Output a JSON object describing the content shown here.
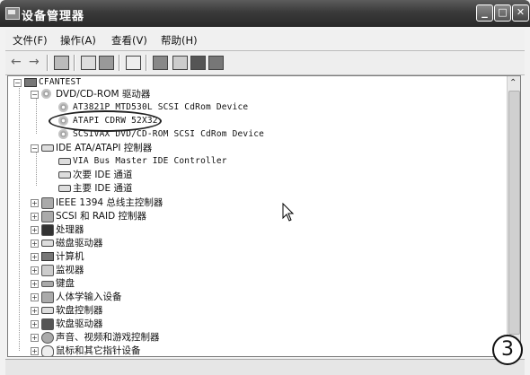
{
  "window": {
    "title": "设备管理器",
    "min_label": "_",
    "max_label": "□",
    "close_label": "✕"
  },
  "menu": [
    {
      "label": "文件(F)"
    },
    {
      "label": "操作(A)"
    },
    {
      "label": "查看(V)"
    },
    {
      "label": "帮助(H)"
    }
  ],
  "toolbar": {
    "back_icon": "arrow-left-icon",
    "forward_icon": "arrow-right-icon",
    "back_glyph": "←",
    "forward_glyph": "→"
  },
  "tree": {
    "root": "CFANTEST",
    "items": [
      {
        "label": "DVD/CD-ROM 驱动器",
        "icon": "cdrom-icon",
        "expander": "−"
      },
      {
        "label": "AT3821P MTD530L SCSI CdRom Device",
        "icon": "cdrom-icon"
      },
      {
        "label": "ATAPI CDRW 52X32",
        "icon": "cdrom-icon"
      },
      {
        "label": "SCSIVAX DVD/CD-ROM SCSI CdRom Device",
        "icon": "cdrom-icon"
      },
      {
        "label": "IDE ATA/ATAPI 控制器",
        "icon": "ide-icon",
        "expander": "−"
      },
      {
        "label": "VIA Bus Master IDE Controller",
        "icon": "ide-icon"
      },
      {
        "label": "次要 IDE 通道",
        "icon": "ide-icon"
      },
      {
        "label": "主要 IDE 通道",
        "icon": "ide-icon"
      },
      {
        "label": "IEEE 1394 总线主控制器",
        "icon": "firewire-icon",
        "expander": "+"
      },
      {
        "label": "SCSI 和 RAID 控制器",
        "icon": "scsi-icon",
        "expander": "+"
      },
      {
        "label": "处理器",
        "icon": "processor-icon",
        "expander": "+"
      },
      {
        "label": "磁盘驱动器",
        "icon": "disk-icon",
        "expander": "+"
      },
      {
        "label": "计算机",
        "icon": "computer-icon",
        "expander": "+"
      },
      {
        "label": "监视器",
        "icon": "monitor-icon",
        "expander": "+"
      },
      {
        "label": "键盘",
        "icon": "keyboard-icon",
        "expander": "+"
      },
      {
        "label": "人体学输入设备",
        "icon": "hid-icon",
        "expander": "+"
      },
      {
        "label": "软盘控制器",
        "icon": "floppy-controller-icon",
        "expander": "+"
      },
      {
        "label": "软盘驱动器",
        "icon": "floppy-icon",
        "expander": "+"
      },
      {
        "label": "声音、视频和游戏控制器",
        "icon": "sound-icon",
        "expander": "+"
      },
      {
        "label": "鼠标和其它指针设备",
        "icon": "mouse-icon",
        "expander": "+"
      }
    ]
  },
  "annotation": {
    "marker": "3"
  },
  "colors": {
    "titlebar": "#3a3a3a",
    "panel": "#ffffff"
  }
}
